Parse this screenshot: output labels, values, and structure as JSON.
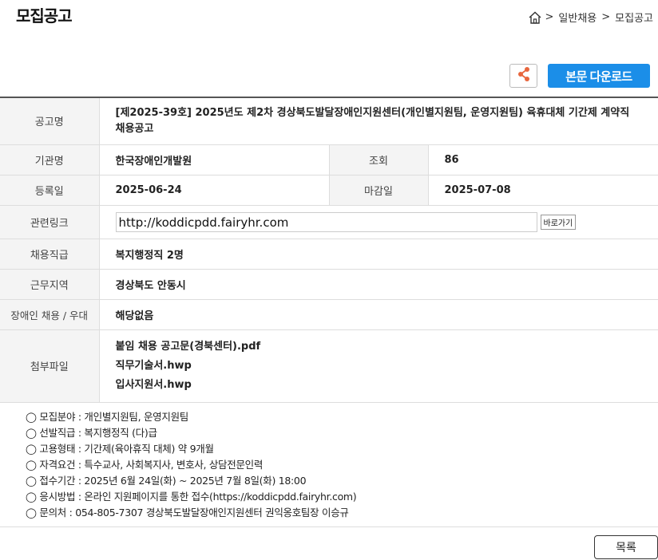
{
  "header": {
    "title": "모집공고",
    "breadcrumb": [
      ">",
      "일반채용",
      ">",
      "모집공고"
    ]
  },
  "actions": {
    "download_label": "본문 다운로드"
  },
  "table": {
    "title_label": "공고명",
    "title_value": "[제2025-39호] 2025년도 제2차 경상북도발달장애인지원센터(개인별지원팀, 운영지원팀) 육휴대체 기간제 계약직 채용공고",
    "org_label": "기관명",
    "org_value": "한국장애인개발원",
    "views_label": "조회",
    "views_value": "86",
    "reg_label": "등록일",
    "reg_value": "2025-06-24",
    "deadline_label": "마감일",
    "deadline_value": "2025-07-08",
    "link_label": "관련링크",
    "link_value": "http://koddicpdd.fairyhr.com",
    "go_label": "바로가기",
    "position_label": "채용직급",
    "position_value": "복지행정직 2명",
    "region_label": "근무지역",
    "region_value": "경상북도 안동시",
    "disability_label": "장애인 채용 / 우대",
    "disability_value": "해당없음",
    "files_label": "첨부파일",
    "files": [
      "붙임 채용 공고문(경북센터).pdf",
      "직무기술서.hwp",
      "입사지원서.hwp"
    ]
  },
  "notice": [
    "◯ 모집분야 : 개인별지원팀, 운영지원팀",
    "◯ 선발직급 : 복지행정직 (다)급",
    "◯ 고용형태 : 기간제(육아휴직 대체) 약 9개월",
    "◯ 자격요건 : 특수교사, 사회복지사, 변호사, 상담전문인력",
    "◯ 접수기간 : 2025년 6월 24일(화) ~ 2025년 7월 8일(화) 18:00",
    "◯ 응시방법 : 온라인 지원페이지를 통한 접수(https://koddicpdd.fairyhr.com)",
    "◯ 문의처 : 054-805-7307 경상북도발달장애인지원센터 권익옹호팀장 이승규"
  ],
  "footer": {
    "list_label": "목록"
  },
  "colors": {
    "accent": "#1b8ee8",
    "share_icon": "#e8663d",
    "header_bg": "#f4f4f4"
  },
  "icons": {
    "home": "home-icon",
    "share": "share-icon"
  }
}
